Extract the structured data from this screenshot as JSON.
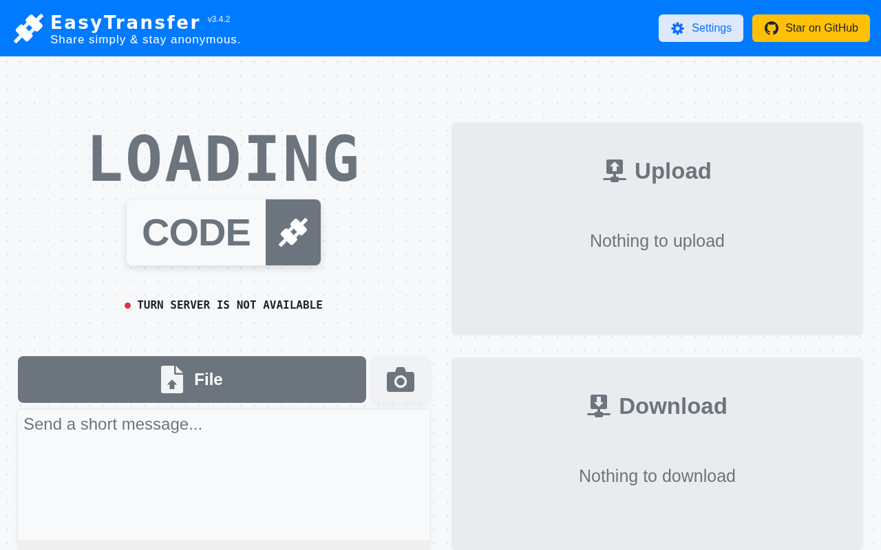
{
  "header": {
    "title": "EasyTransfer",
    "version": "v3.4.2",
    "tagline": "Share simply & stay anonymous.",
    "buttons": [
      {
        "kind": "settings",
        "label": "Settings"
      },
      {
        "kind": "github",
        "label": "Star on GitHub"
      }
    ]
  },
  "code_panel": {
    "heading": "LOADING",
    "code_label": "CODE",
    "status": {
      "text": "TURN SERVER IS NOT AVAILABLE",
      "color": "#dc3545"
    }
  },
  "composer": {
    "file_button": "File",
    "message": {
      "placeholder": "Send a short message..."
    }
  },
  "transfers": [
    {
      "kind": "upload",
      "title": "Upload",
      "empty_text": "Nothing to upload"
    },
    {
      "kind": "download",
      "title": "Download",
      "empty_text": "Nothing to download"
    }
  ]
}
